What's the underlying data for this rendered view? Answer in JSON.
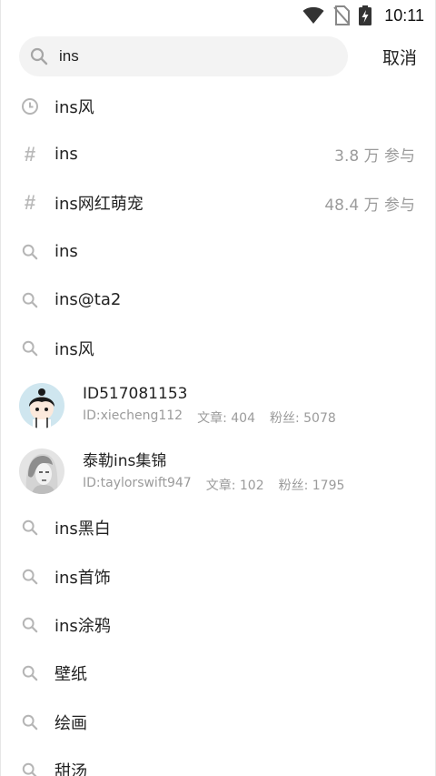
{
  "status_bar": {
    "time": "10:11"
  },
  "search": {
    "value": "ins",
    "placeholder": ""
  },
  "cancel_label": "取消",
  "suggestions_top": [
    {
      "type": "history",
      "icon": "clock-icon",
      "label": "ins风"
    },
    {
      "type": "topic",
      "icon": "hash-icon",
      "label": "ins",
      "meta": "3.8 万 参与"
    },
    {
      "type": "topic",
      "icon": "hash-icon",
      "label": "ins网红萌宠",
      "meta": "48.4 万 参与"
    },
    {
      "type": "search",
      "icon": "search-icon",
      "label": "ins"
    },
    {
      "type": "search",
      "icon": "search-icon",
      "label": "ins@ta2"
    },
    {
      "type": "search",
      "icon": "search-icon",
      "label": "ins风"
    }
  ],
  "users": [
    {
      "name": "ID517081153",
      "id_text": "ID:xiecheng112",
      "articles": "文章: 404",
      "fans": "粉丝: 5078",
      "avatar": "cartoon-girl-avatar"
    },
    {
      "name": "泰勒ins集锦",
      "id_text": "ID:taylorswift947",
      "articles": "文章: 102",
      "fans": "粉丝: 1795",
      "avatar": "photo-portrait-avatar"
    }
  ],
  "suggestions_bottom": [
    {
      "type": "search",
      "icon": "search-icon",
      "label": "ins黑白"
    },
    {
      "type": "search",
      "icon": "search-icon",
      "label": "ins首饰"
    },
    {
      "type": "search",
      "icon": "search-icon",
      "label": "ins涂鸦"
    },
    {
      "type": "search",
      "icon": "search-icon",
      "label": "壁纸"
    },
    {
      "type": "search",
      "icon": "search-icon",
      "label": "绘画"
    },
    {
      "type": "search",
      "icon": "search-icon",
      "label": "甜汤"
    }
  ]
}
